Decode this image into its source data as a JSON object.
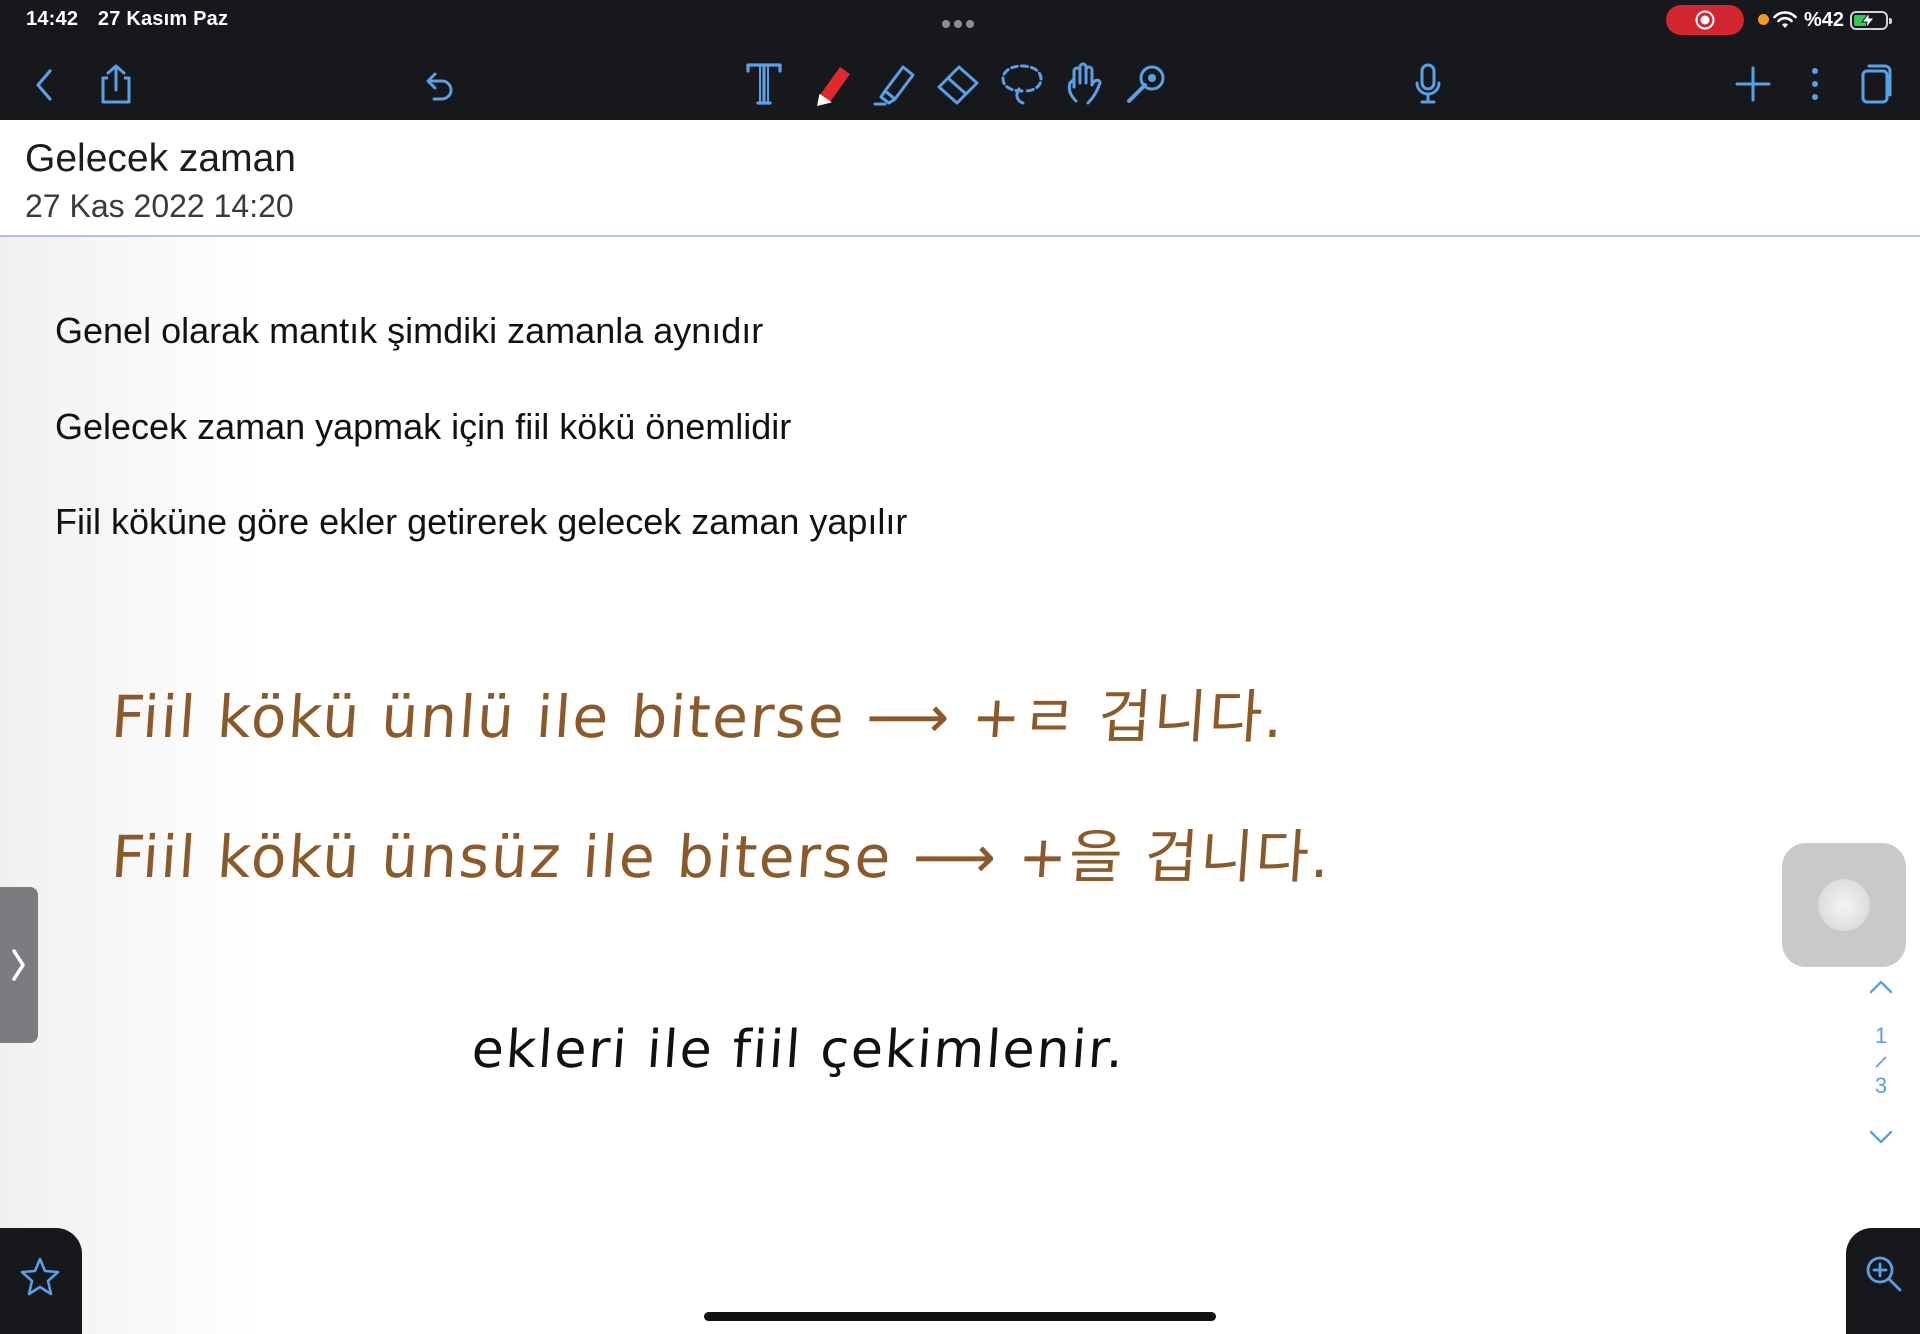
{
  "status_bar": {
    "time": "14:42",
    "date": "27 Kasım Paz",
    "battery": "%42",
    "battery_level_percent": 42
  },
  "toolbar": {
    "icons": [
      "back-icon",
      "share-icon",
      "undo-icon",
      "text-tool-icon",
      "pen-icon",
      "highlighter-icon",
      "eraser-icon",
      "lasso-icon",
      "hand-tool-icon",
      "laser-pointer-icon",
      "microphone-icon",
      "plus-icon",
      "more-icon",
      "pages-icon"
    ],
    "active_tool": "pen",
    "pen_color": "#e0282e",
    "icon_color": "#5aa0e6"
  },
  "note": {
    "title": "Gelecek zaman",
    "date": "27 Kas 2022 14:20"
  },
  "typed_lines": [
    "Genel olarak mantık şimdiki zamanla aynıdır",
    "Gelecek zaman yapmak için fiil kökü önemlidir",
    "Fiil köküne göre ekler getirerek gelecek zaman yapılır"
  ],
  "handwriting": {
    "line1": "Fiil  kökü  ünlü  ile  biterse  ⟶  +ㄹ  겁니다.",
    "line2": "Fiil  kökü  ünsüz  ile  biterse  ⟶ +을  겁니다.",
    "line3": "ekleri  ile   fiil  çekimlenir.",
    "ink_colors": {
      "brown": "#8b5a2b",
      "black": "#111111"
    }
  },
  "pager": {
    "current": "1",
    "total": "3"
  },
  "bottom_icons": [
    "star-icon",
    "zoom-in-icon"
  ]
}
